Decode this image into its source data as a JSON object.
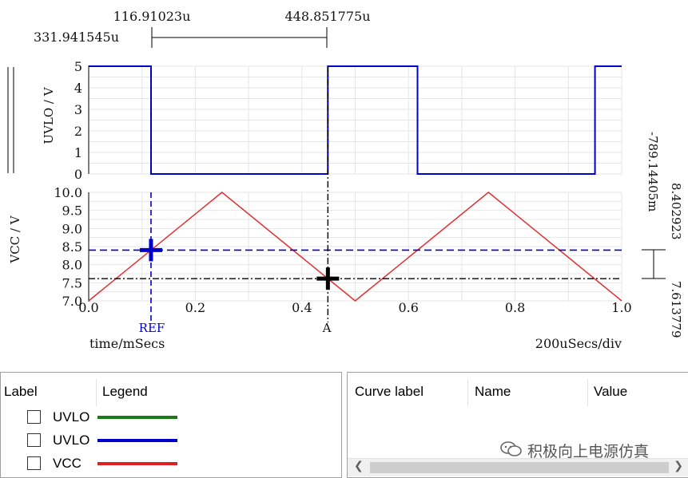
{
  "chart_data": [
    {
      "type": "line",
      "ylabel": "UVLO / V",
      "xlim": [
        0,
        1.0
      ],
      "ylim": [
        0,
        5
      ],
      "yticks": [
        "5",
        "4",
        "3",
        "2",
        "1",
        "0"
      ],
      "grid": true,
      "series": [
        {
          "name": "UVLO",
          "color": "#0000cc",
          "x": [
            0,
            0.1169,
            0.1169,
            0.4488,
            0.4488,
            0.617,
            0.617,
            0.95,
            0.95,
            1.0
          ],
          "y": [
            5,
            5,
            0,
            0,
            5,
            5,
            0,
            0,
            5,
            5
          ]
        }
      ]
    },
    {
      "type": "line",
      "ylabel": "VCC / V",
      "xlabel": "time/mSecs",
      "xlim": [
        0,
        1.0
      ],
      "ylim": [
        7.0,
        10.0
      ],
      "xticks": [
        "0.0",
        "0.2",
        "0.4",
        "0.6",
        "0.8",
        "1.0"
      ],
      "yticks": [
        "10.0",
        "9.5",
        "9.0",
        "8.5",
        "8.0",
        "7.5",
        "7.0"
      ],
      "grid": true,
      "series": [
        {
          "name": "VCC",
          "color": "#e03030",
          "x": [
            0,
            0.25,
            0.5,
            0.75,
            1.0
          ],
          "y": [
            7.0,
            10.0,
            7.0,
            10.0,
            7.0
          ]
        }
      ]
    }
  ],
  "cursors": {
    "ref": {
      "label": "REF",
      "x": 0.1169,
      "y": 8.402923,
      "color": "#0000cc"
    },
    "a": {
      "label": "A",
      "x": 0.4488,
      "y": 7.613779,
      "color": "#000000"
    }
  },
  "measure": {
    "ref_time": "116.91023u",
    "a_time": "448.851775u",
    "delta_time": "331.941545u",
    "delta_value": "-789.14405m",
    "ref_value": "8.402923",
    "a_value": "7.613779"
  },
  "x_scale": "200uSecs/div",
  "legend_panel": {
    "headers": [
      "Label",
      "Legend"
    ],
    "rows": [
      {
        "label": "UVLO",
        "color": "#1a7a1a"
      },
      {
        "label": "UVLO",
        "color": "#0000cc"
      },
      {
        "label": "VCC",
        "color": "#e02020"
      }
    ]
  },
  "values_panel": {
    "headers": [
      "Curve label",
      "Name",
      "Value"
    ]
  },
  "watermark": "积极向上电源仿真",
  "icons": {
    "scroll_left": "chevron-left-icon",
    "scroll_right": "chevron-right-icon",
    "watermark": "wechat-icon"
  }
}
